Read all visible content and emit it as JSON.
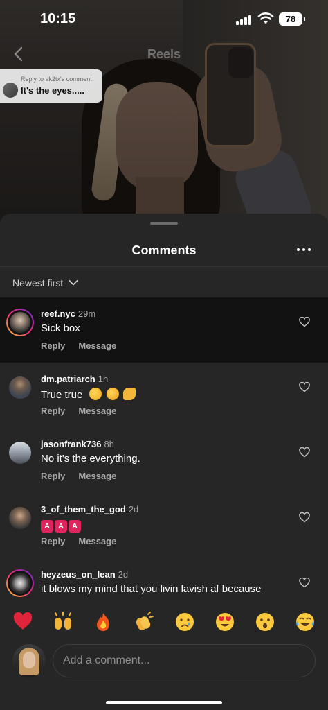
{
  "status_bar": {
    "time": "10:15",
    "battery": "78"
  },
  "reel": {
    "title": "Reels",
    "reply_chip": {
      "caption": "Reply to ak2tx's comment",
      "text": "It's the eyes....."
    }
  },
  "sheet": {
    "title": "Comments",
    "sort_label": "Newest first"
  },
  "comments": [
    {
      "user": "reef.nyc",
      "time": "29m",
      "text": "Sick box",
      "reply": "Reply",
      "message": "Message",
      "highlight": true,
      "story_ring": true,
      "avatar_color": "#3a3a3a"
    },
    {
      "user": "dm.patriarch",
      "time": "1h",
      "text": "True true",
      "emojis": [
        "grinning-sweat",
        "flushed-hands",
        "flexed-biceps"
      ],
      "reply": "Reply",
      "message": "Message",
      "story_ring": false,
      "avatar_color": "#55606b"
    },
    {
      "user": "jasonfrank736",
      "time": "8h",
      "text": "No it's the everything.",
      "reply": "Reply",
      "message": "Message",
      "story_ring": false,
      "avatar_color": "#6d7680"
    },
    {
      "user": "3_of_them_the_god",
      "time": "2d",
      "text": "",
      "emoji_chips": [
        "A",
        "A",
        "A"
      ],
      "reply": "Reply",
      "message": "Message",
      "story_ring": false,
      "avatar_color": "#4d4d4d"
    },
    {
      "user": "heyzeus_on_lean",
      "time": "2d",
      "text": "it blows my mind that you livin lavish af because",
      "reply": "Reply",
      "message": "Message",
      "story_ring": true,
      "avatar_color": "#2d2d2d"
    }
  ],
  "reactions": [
    "red-heart",
    "raising-hands",
    "fire",
    "clapping-hands",
    "crying-face",
    "heart-eyes-face",
    "surprised-face",
    "tears-of-joy-face"
  ],
  "input": {
    "placeholder": "Add a comment..."
  },
  "colors": {
    "sheet_bg": "#262626",
    "highlight_row": "#121212",
    "secondary_text": "#a8a8a8",
    "chip_red": "#e0245e"
  }
}
